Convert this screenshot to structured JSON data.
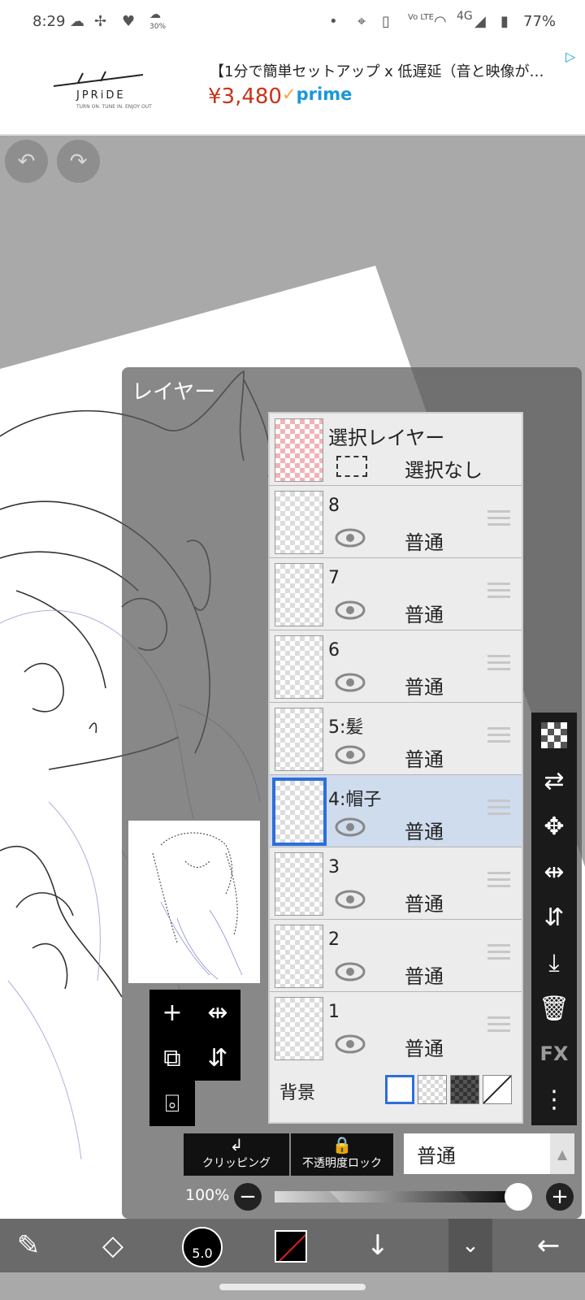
{
  "status": {
    "time": "8:29",
    "weather_sub": "30%",
    "network": "4G",
    "battery": "77%"
  },
  "ad": {
    "brand": "JPRiDE",
    "brand_tagline": "TURN ON. TUNE IN. ENJOY OUT",
    "title": "【1分で簡単セットアップ x 低遅延（音と映像が…",
    "price": "¥3,480",
    "prime_label": "prime"
  },
  "panel": {
    "title": "レイヤー"
  },
  "selection_layer": {
    "label": "選択レイヤー",
    "state": "選択なし"
  },
  "layers": [
    {
      "name": "8",
      "mode": "普通",
      "selected": false
    },
    {
      "name": "7",
      "mode": "普通",
      "selected": false
    },
    {
      "name": "6",
      "mode": "普通",
      "selected": false
    },
    {
      "name": "5:髪",
      "mode": "普通",
      "selected": false
    },
    {
      "name": "4:帽子",
      "mode": "普通",
      "selected": true
    },
    {
      "name": "3",
      "mode": "普通",
      "selected": false
    },
    {
      "name": "2",
      "mode": "普通",
      "selected": false
    },
    {
      "name": "1",
      "mode": "普通",
      "selected": false
    }
  ],
  "background": {
    "label": "背景"
  },
  "controls": {
    "clipping_label": "クリッピング",
    "opacity_lock_label": "不透明度ロック",
    "blend_mode": "普通",
    "opacity_value": "100%",
    "opacity": 1.0
  },
  "right_tools": {
    "fx_label": "FX"
  },
  "bottom_tools": {
    "brush_size": "5.0"
  },
  "colors": {
    "selected_layer": "#cfdcee",
    "selected_border": "#2c6fdc",
    "price": "#c7341a",
    "prime": "#1998d8"
  }
}
